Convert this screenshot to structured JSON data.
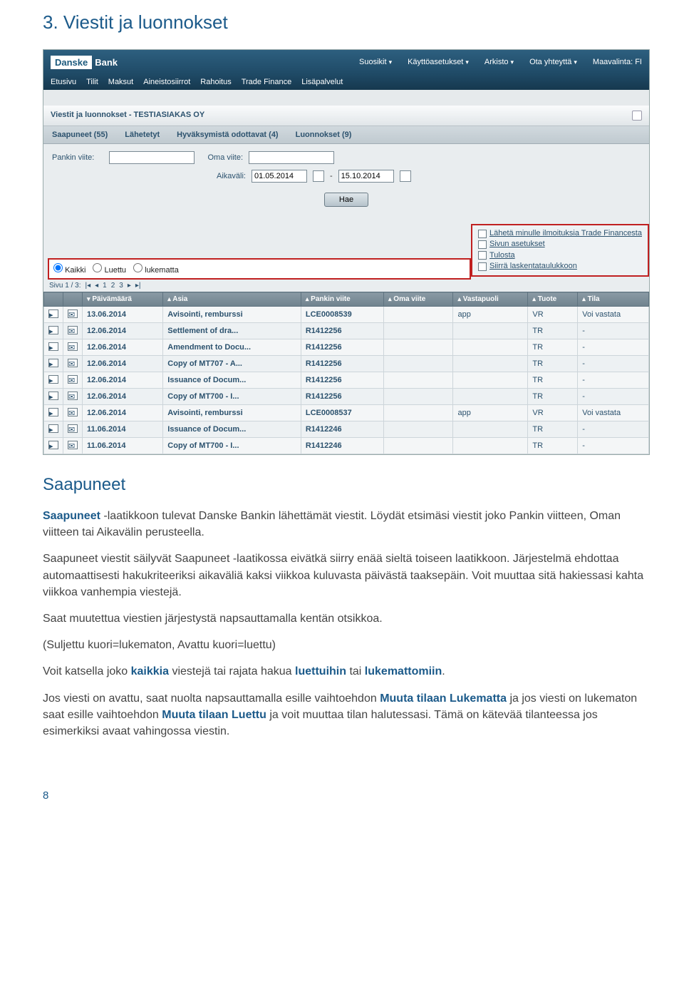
{
  "doc": {
    "section_title": "3. Viestit ja luonnokset",
    "sub_title": "Saapuneet",
    "p1_a": "Saapuneet",
    "p1_b": " -laatikkoon tulevat Danske Bankin lähettämät viestit. Löydät etsimäsi viestit joko Pankin viitteen, Oman viitteen tai Aikavälin perusteella.",
    "p2": "Saapuneet viestit säilyvät Saapuneet -laatikossa eivätkä siirry enää sieltä toiseen laatikkoon. Järjestelmä ehdottaa automaattisesti hakukriteeriksi aikaväliä kaksi viikkoa kuluvasta päivästä taaksepäin. Voit muuttaa sitä hakiessasi kahta viikkoa vanhempia viestejä.",
    "p3": "Saat muutettua viestien järjestystä napsauttamalla kentän otsikkoa.",
    "p4": "(Suljettu kuori=lukematon, Avattu kuori=luettu)",
    "p5_a": "Voit katsella joko ",
    "p5_b1": "kaikkia",
    "p5_c": " viestejä tai rajata hakua ",
    "p5_b2": "luettuihin",
    "p5_d": " tai ",
    "p5_b3": "lukemattomiin",
    "p5_e": ".",
    "p6_a": "Jos viesti on avattu, saat nuolta napsauttamalla esille vaihtoehdon ",
    "p6_b1": "Muuta tilaan Lukematta",
    "p6_c": " ja jos viesti on lukematon saat esille vaihtoehdon ",
    "p6_b2": "Muuta tilaan Luettu",
    "p6_d": " ja voit muuttaa tilan halutessasi. Tämä on kätevää tilanteessa jos esimerkiksi avaat vahingossa viestin.",
    "page_num": "8"
  },
  "top_menu": {
    "suosikit": "Suosikit",
    "kayttoasetukset": "Käyttöasetukset",
    "arkisto": "Arkisto",
    "ota_yhteytta": "Ota yhteyttä",
    "maavalinta": "Maavalinta: FI"
  },
  "nav": {
    "etusivu": "Etusivu",
    "tilit": "Tilit",
    "maksut": "Maksut",
    "aineistosiirrot": "Aineistosiirrot",
    "rahoitus": "Rahoitus",
    "trade_finance": "Trade Finance",
    "lisapalvelut": "Lisäpalvelut"
  },
  "panel_title": "Viestit ja luonnokset - TESTIASIAKAS OY",
  "tabs": {
    "saapuneet": "Saapuneet (55)",
    "lahetetyt": "Lähetetyt",
    "hyvaksymista": "Hyväksymistä odottavat (4)",
    "luonnokset": "Luonnokset (9)"
  },
  "filters": {
    "pankin_viite_label": "Pankin viite:",
    "oma_viite_label": "Oma viite:",
    "aikavali_label": "Aikaväli:",
    "date_from": "01.05.2014",
    "date_to": "15.10.2014",
    "sep": "-",
    "hae": "Hae"
  },
  "radios": {
    "kaikki": "Kaikki",
    "luettu": "Luettu",
    "lukematta": "lukematta"
  },
  "actions": {
    "laheta": "Lähetä minulle ilmoituksia Trade Financesta",
    "sivun": "Sivun asetukset",
    "tulosta": "Tulosta",
    "siirra": "Siirrä laskentataulukkoon"
  },
  "pager": "Sivu 1 / 3:",
  "cols": {
    "paivamaara": "Päivämäärä",
    "asia": "Asia",
    "pankin_viite": "Pankin viite",
    "oma_viite": "Oma viite",
    "vastapuoli": "Vastapuoli",
    "tuote": "Tuote",
    "tila": "Tila"
  },
  "rows": [
    {
      "date": "13.06.2014",
      "subject": "Avisointi, remburssi",
      "ref": "LCE0008539",
      "own": "",
      "counter": "app",
      "product": "VR",
      "status": "Voi vastata"
    },
    {
      "date": "12.06.2014",
      "subject": "Settlement of dra...",
      "ref": "R1412256",
      "own": "",
      "counter": "",
      "product": "TR",
      "status": "-"
    },
    {
      "date": "12.06.2014",
      "subject": "Amendment to Docu...",
      "ref": "R1412256",
      "own": "",
      "counter": "",
      "product": "TR",
      "status": "-"
    },
    {
      "date": "12.06.2014",
      "subject": "Copy of MT707 - A...",
      "ref": "R1412256",
      "own": "",
      "counter": "",
      "product": "TR",
      "status": "-"
    },
    {
      "date": "12.06.2014",
      "subject": "Issuance of Docum...",
      "ref": "R1412256",
      "own": "",
      "counter": "",
      "product": "TR",
      "status": "-"
    },
    {
      "date": "12.06.2014",
      "subject": "Copy of MT700 - I...",
      "ref": "R1412256",
      "own": "",
      "counter": "",
      "product": "TR",
      "status": "-"
    },
    {
      "date": "12.06.2014",
      "subject": "Avisointi, remburssi",
      "ref": "LCE0008537",
      "own": "",
      "counter": "app",
      "product": "VR",
      "status": "Voi vastata"
    },
    {
      "date": "11.06.2014",
      "subject": "Issuance of Docum...",
      "ref": "R1412246",
      "own": "",
      "counter": "",
      "product": "TR",
      "status": "-"
    },
    {
      "date": "11.06.2014",
      "subject": "Copy of MT700 - I...",
      "ref": "R1412246",
      "own": "",
      "counter": "",
      "product": "TR",
      "status": "-"
    }
  ],
  "logo": {
    "brand1": "Danske",
    "brand2": "Bank"
  }
}
